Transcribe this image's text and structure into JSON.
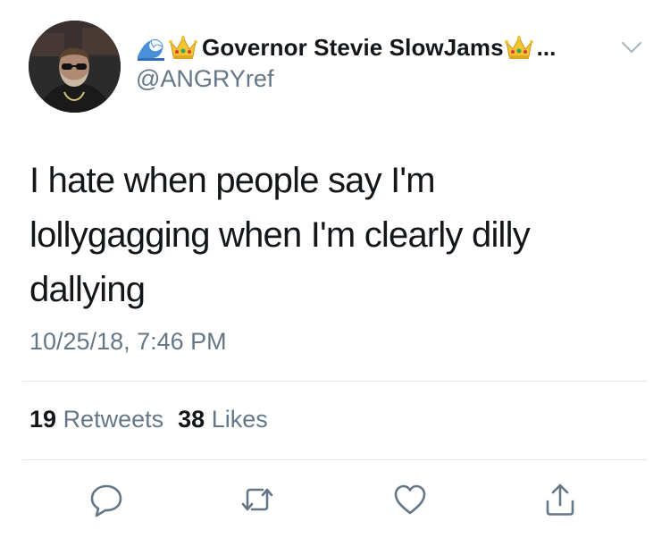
{
  "tweet": {
    "author": {
      "display_name": "Governor Stevie SlowJams",
      "truncation": "...",
      "handle": "@ANGRYref",
      "name_emojis_before": [
        "water-wave-icon",
        "crown-icon"
      ],
      "name_emojis_after": [
        "crown-icon"
      ]
    },
    "text_lines": [
      "I hate when people say I'm",
      "lollygagging when I'm clearly dilly",
      "dallying"
    ],
    "timestamp": "10/25/18, 7:46 PM",
    "stats": {
      "retweets_count": "19",
      "retweets_label": "Retweets",
      "likes_count": "38",
      "likes_label": "Likes"
    },
    "actions": [
      "reply-icon",
      "retweet-icon",
      "like-icon",
      "share-icon"
    ]
  },
  "colors": {
    "primary_text": "#14171a",
    "secondary_text": "#657786",
    "divider": "#e1e8ed",
    "action_icon": "#657786"
  }
}
